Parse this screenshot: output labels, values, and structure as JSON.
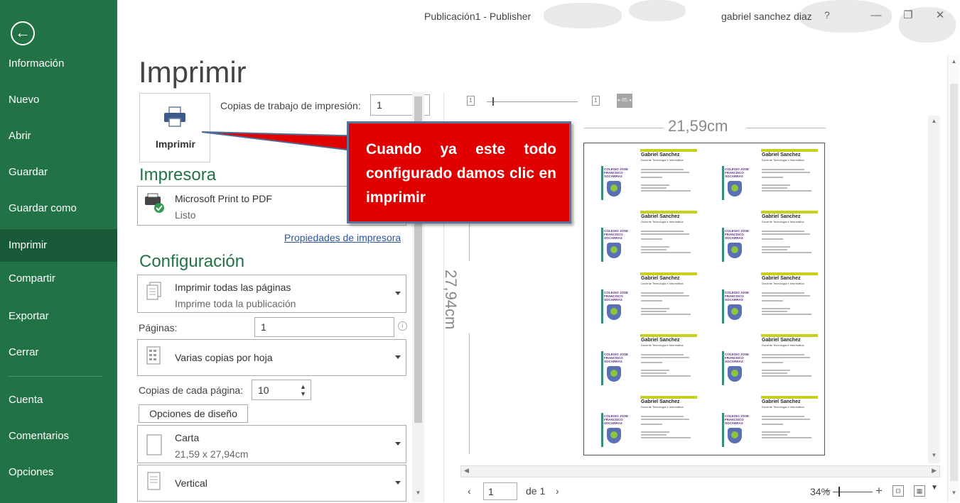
{
  "window": {
    "title": "Publicación1  -  Publisher",
    "user": "gabriel sanchez diaz",
    "help": "?",
    "minimize": "—",
    "restore": "❐",
    "close": "✕"
  },
  "sidebar": {
    "back": "←",
    "items": [
      {
        "label": "Información"
      },
      {
        "label": "Nuevo"
      },
      {
        "label": "Abrir"
      },
      {
        "label": "Guardar"
      },
      {
        "label": "Guardar como"
      },
      {
        "label": "Imprimir"
      },
      {
        "label": "Compartir"
      },
      {
        "label": "Exportar"
      },
      {
        "label": "Cerrar"
      },
      {
        "label": "Cuenta"
      },
      {
        "label": "Comentarios"
      },
      {
        "label": "Opciones"
      }
    ]
  },
  "main": {
    "heading": "Imprimir",
    "print_button": "Imprimir",
    "copies_label": "Copias de trabajo de impresión:",
    "copies_value": "1",
    "printer_section": "Impresora",
    "printer_name": "Microsoft Print to PDF",
    "printer_status": "Listo",
    "printer_props": "Propiedades de impresora",
    "config_section": "Configuración",
    "print_pages": "Imprimir todas las páginas",
    "print_pages_desc": "Imprime toda la publicación",
    "pages_label": "Páginas:",
    "pages_value": "1",
    "layout": "Varias copias por hoja",
    "copies_per_page_label": "Copias de cada página:",
    "copies_per_page_value": "10",
    "design_options": "Opciones de diseño",
    "paper": "Carta",
    "paper_size": "21,59 x 27,94cm",
    "orientation": "Vertical"
  },
  "preview": {
    "width": "21,59cm",
    "height": "27,94cm",
    "card": {
      "name": "Gabriel Sanchez",
      "role": "Docente Tecnología e Informática",
      "school": "COLEGIO JOSE FRANCISCO SOCARRAS"
    },
    "page_current": "1",
    "page_of": "de 1",
    "zoom": "34%"
  },
  "callout": {
    "text": "Cuando ya este todo configurado damos clic en imprimir"
  },
  "colors": {
    "brand": "#217346",
    "callout": "#e00000"
  }
}
